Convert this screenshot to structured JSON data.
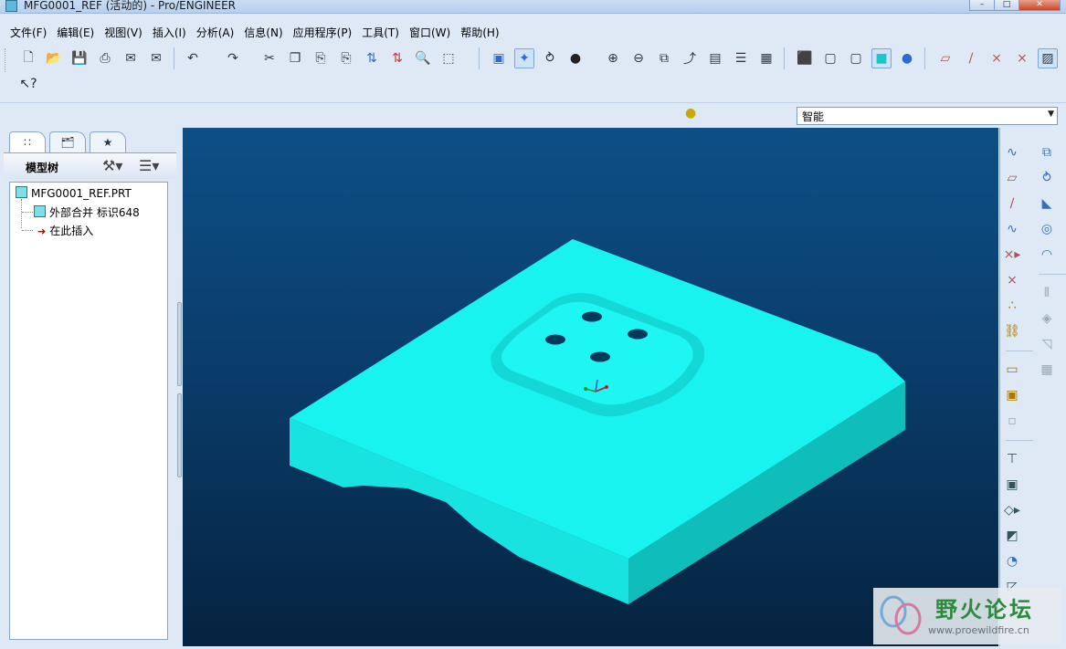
{
  "window": {
    "title": "MFG0001_REF (活动的) - Pro/ENGINEER",
    "buttons": [
      "minimize",
      "maximize",
      "close"
    ]
  },
  "menu": {
    "items": [
      "文件(F)",
      "编辑(E)",
      "视图(V)",
      "插入(I)",
      "分析(A)",
      "信息(N)",
      "应用程序(P)",
      "工具(T)",
      "窗口(W)",
      "帮助(H)"
    ]
  },
  "toolbar": {
    "icons": [
      "new-icon",
      "open-icon",
      "save-icon",
      "print-icon",
      "email-icon",
      "mail-attach-icon",
      "undo-icon",
      "redo-icon",
      "cut-icon",
      "copy-icon",
      "paste-icon",
      "paste-special-icon",
      "regenerate-icon",
      "regen-manager-icon",
      "find-icon",
      "select-box-icon",
      "repaint-icon",
      "spin-center-icon",
      "orient-icon",
      "appearance-icon",
      "zoom-in-icon",
      "zoom-out-icon",
      "refit-icon",
      "reorient-icon",
      "saved-views-icon",
      "layers-icon",
      "view-manager-icon",
      "wireframe-icon",
      "hidden-line-icon",
      "no-hidden-icon",
      "shading-icon",
      "enhanced-realism-icon",
      "datum-planes-icon",
      "datum-axes-icon",
      "datum-points-icon",
      "coord-sys-icon",
      "annotations-icon",
      "whats-this-icon"
    ]
  },
  "filter": {
    "selected": "智能"
  },
  "model_tree": {
    "header": "模型树",
    "nodes": [
      {
        "label": "MFG0001_REF.PRT"
      },
      {
        "label": "外部合并 标识648"
      },
      {
        "label": "在此插入"
      }
    ]
  },
  "right_toolbar": {
    "icons": [
      "sketch-icon",
      "datum-plane-icon",
      "datum-axis-icon",
      "datum-curve-icon",
      "datum-point-icon",
      "csys-icon",
      "analysis-feature-icon",
      "offset-csys-icon",
      "extrude-tool-icon",
      "revolve-tool-icon",
      "sweep-tool-icon",
      "hole-tool-icon",
      "round-tool-icon",
      "chamfer-tool-icon",
      "draft-tool-icon",
      "shell-tool-icon",
      "rib-tool-icon",
      "mirror-tool-icon",
      "merge-tool-icon",
      "trim-tool-icon",
      "pattern-tool-icon",
      "copy-tool-icon",
      "project-tool-icon",
      "intersect-tool-icon",
      "offset-tool-icon",
      "thicken-tool-icon",
      "solidify-tool-icon",
      "style-tool-icon",
      "boundary-blend-icon"
    ]
  },
  "watermark": {
    "name": "野火论坛",
    "url": "www.proewildfire.cn"
  },
  "colors": {
    "model": "#19f3f0",
    "viewport_top": "#0d4f86",
    "viewport_bottom": "#052340"
  }
}
